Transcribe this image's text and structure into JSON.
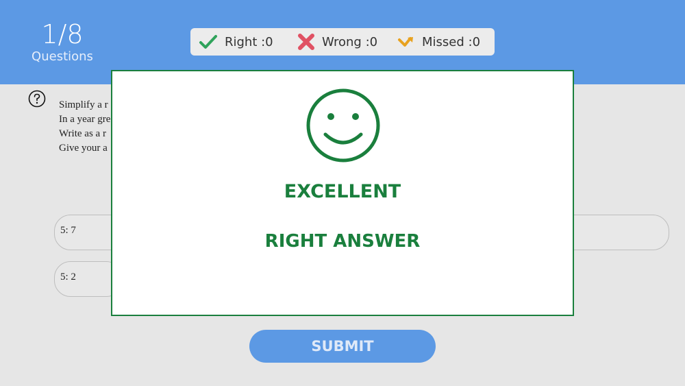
{
  "header": {
    "counter": {
      "value": "1/8",
      "label": "Questions"
    }
  },
  "scoreboard": {
    "right": {
      "label": "Right :0",
      "icon": "check-icon",
      "color": "#2fa35b"
    },
    "wrong": {
      "label": "Wrong :0",
      "icon": "x-icon",
      "color": "#e05163"
    },
    "missed": {
      "label": "Missed :0",
      "icon": "missed-arrow-icon",
      "color": "#e8a21f"
    }
  },
  "question": {
    "icon": "help-icon",
    "lines": [
      "Simplify a r",
      "In a year gre",
      "Write as a r",
      "Give your a"
    ]
  },
  "options": [
    {
      "label": "5: 7"
    },
    {
      "label": "5: 2"
    }
  ],
  "submit_label": "SUBMIT",
  "feedback": {
    "icon": "smiley-icon",
    "title": "EXCELLENT",
    "subtitle": "RIGHT ANSWER",
    "color": "#1a7f3d"
  },
  "colors": {
    "header": "#5c99e4",
    "background": "#e6e6e6"
  }
}
